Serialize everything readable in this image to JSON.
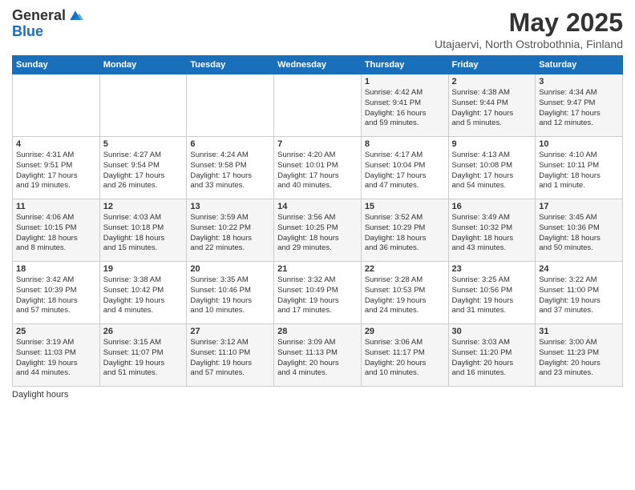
{
  "logo": {
    "general": "General",
    "blue": "Blue"
  },
  "title": "May 2025",
  "subtitle": "Utajaervi, North Ostrobothnia, Finland",
  "days_of_week": [
    "Sunday",
    "Monday",
    "Tuesday",
    "Wednesday",
    "Thursday",
    "Friday",
    "Saturday"
  ],
  "footer": {
    "daylight_hours_label": "Daylight hours"
  },
  "weeks": [
    [
      {
        "num": "",
        "info": ""
      },
      {
        "num": "",
        "info": ""
      },
      {
        "num": "",
        "info": ""
      },
      {
        "num": "",
        "info": ""
      },
      {
        "num": "1",
        "info": "Sunrise: 4:42 AM\nSunset: 9:41 PM\nDaylight: 16 hours\nand 59 minutes."
      },
      {
        "num": "2",
        "info": "Sunrise: 4:38 AM\nSunset: 9:44 PM\nDaylight: 17 hours\nand 5 minutes."
      },
      {
        "num": "3",
        "info": "Sunrise: 4:34 AM\nSunset: 9:47 PM\nDaylight: 17 hours\nand 12 minutes."
      }
    ],
    [
      {
        "num": "4",
        "info": "Sunrise: 4:31 AM\nSunset: 9:51 PM\nDaylight: 17 hours\nand 19 minutes."
      },
      {
        "num": "5",
        "info": "Sunrise: 4:27 AM\nSunset: 9:54 PM\nDaylight: 17 hours\nand 26 minutes."
      },
      {
        "num": "6",
        "info": "Sunrise: 4:24 AM\nSunset: 9:58 PM\nDaylight: 17 hours\nand 33 minutes."
      },
      {
        "num": "7",
        "info": "Sunrise: 4:20 AM\nSunset: 10:01 PM\nDaylight: 17 hours\nand 40 minutes."
      },
      {
        "num": "8",
        "info": "Sunrise: 4:17 AM\nSunset: 10:04 PM\nDaylight: 17 hours\nand 47 minutes."
      },
      {
        "num": "9",
        "info": "Sunrise: 4:13 AM\nSunset: 10:08 PM\nDaylight: 17 hours\nand 54 minutes."
      },
      {
        "num": "10",
        "info": "Sunrise: 4:10 AM\nSunset: 10:11 PM\nDaylight: 18 hours\nand 1 minute."
      }
    ],
    [
      {
        "num": "11",
        "info": "Sunrise: 4:06 AM\nSunset: 10:15 PM\nDaylight: 18 hours\nand 8 minutes."
      },
      {
        "num": "12",
        "info": "Sunrise: 4:03 AM\nSunset: 10:18 PM\nDaylight: 18 hours\nand 15 minutes."
      },
      {
        "num": "13",
        "info": "Sunrise: 3:59 AM\nSunset: 10:22 PM\nDaylight: 18 hours\nand 22 minutes."
      },
      {
        "num": "14",
        "info": "Sunrise: 3:56 AM\nSunset: 10:25 PM\nDaylight: 18 hours\nand 29 minutes."
      },
      {
        "num": "15",
        "info": "Sunrise: 3:52 AM\nSunset: 10:29 PM\nDaylight: 18 hours\nand 36 minutes."
      },
      {
        "num": "16",
        "info": "Sunrise: 3:49 AM\nSunset: 10:32 PM\nDaylight: 18 hours\nand 43 minutes."
      },
      {
        "num": "17",
        "info": "Sunrise: 3:45 AM\nSunset: 10:36 PM\nDaylight: 18 hours\nand 50 minutes."
      }
    ],
    [
      {
        "num": "18",
        "info": "Sunrise: 3:42 AM\nSunset: 10:39 PM\nDaylight: 18 hours\nand 57 minutes."
      },
      {
        "num": "19",
        "info": "Sunrise: 3:38 AM\nSunset: 10:42 PM\nDaylight: 19 hours\nand 4 minutes."
      },
      {
        "num": "20",
        "info": "Sunrise: 3:35 AM\nSunset: 10:46 PM\nDaylight: 19 hours\nand 10 minutes."
      },
      {
        "num": "21",
        "info": "Sunrise: 3:32 AM\nSunset: 10:49 PM\nDaylight: 19 hours\nand 17 minutes."
      },
      {
        "num": "22",
        "info": "Sunrise: 3:28 AM\nSunset: 10:53 PM\nDaylight: 19 hours\nand 24 minutes."
      },
      {
        "num": "23",
        "info": "Sunrise: 3:25 AM\nSunset: 10:56 PM\nDaylight: 19 hours\nand 31 minutes."
      },
      {
        "num": "24",
        "info": "Sunrise: 3:22 AM\nSunset: 11:00 PM\nDaylight: 19 hours\nand 37 minutes."
      }
    ],
    [
      {
        "num": "25",
        "info": "Sunrise: 3:19 AM\nSunset: 11:03 PM\nDaylight: 19 hours\nand 44 minutes."
      },
      {
        "num": "26",
        "info": "Sunrise: 3:15 AM\nSunset: 11:07 PM\nDaylight: 19 hours\nand 51 minutes."
      },
      {
        "num": "27",
        "info": "Sunrise: 3:12 AM\nSunset: 11:10 PM\nDaylight: 19 hours\nand 57 minutes."
      },
      {
        "num": "28",
        "info": "Sunrise: 3:09 AM\nSunset: 11:13 PM\nDaylight: 20 hours\nand 4 minutes."
      },
      {
        "num": "29",
        "info": "Sunrise: 3:06 AM\nSunset: 11:17 PM\nDaylight: 20 hours\nand 10 minutes."
      },
      {
        "num": "30",
        "info": "Sunrise: 3:03 AM\nSunset: 11:20 PM\nDaylight: 20 hours\nand 16 minutes."
      },
      {
        "num": "31",
        "info": "Sunrise: 3:00 AM\nSunset: 11:23 PM\nDaylight: 20 hours\nand 23 minutes."
      }
    ]
  ]
}
